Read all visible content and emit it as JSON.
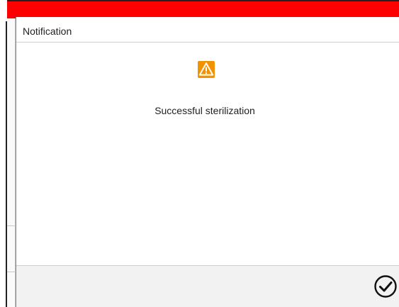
{
  "dialog": {
    "title": "Notification",
    "icon": "warning-icon",
    "message": "Successful sterilization",
    "confirm_icon": "checkmark-circle-icon"
  },
  "colors": {
    "status_bar": "#ff0000",
    "warning": "#f39200",
    "footer": "#f2f2f2"
  }
}
